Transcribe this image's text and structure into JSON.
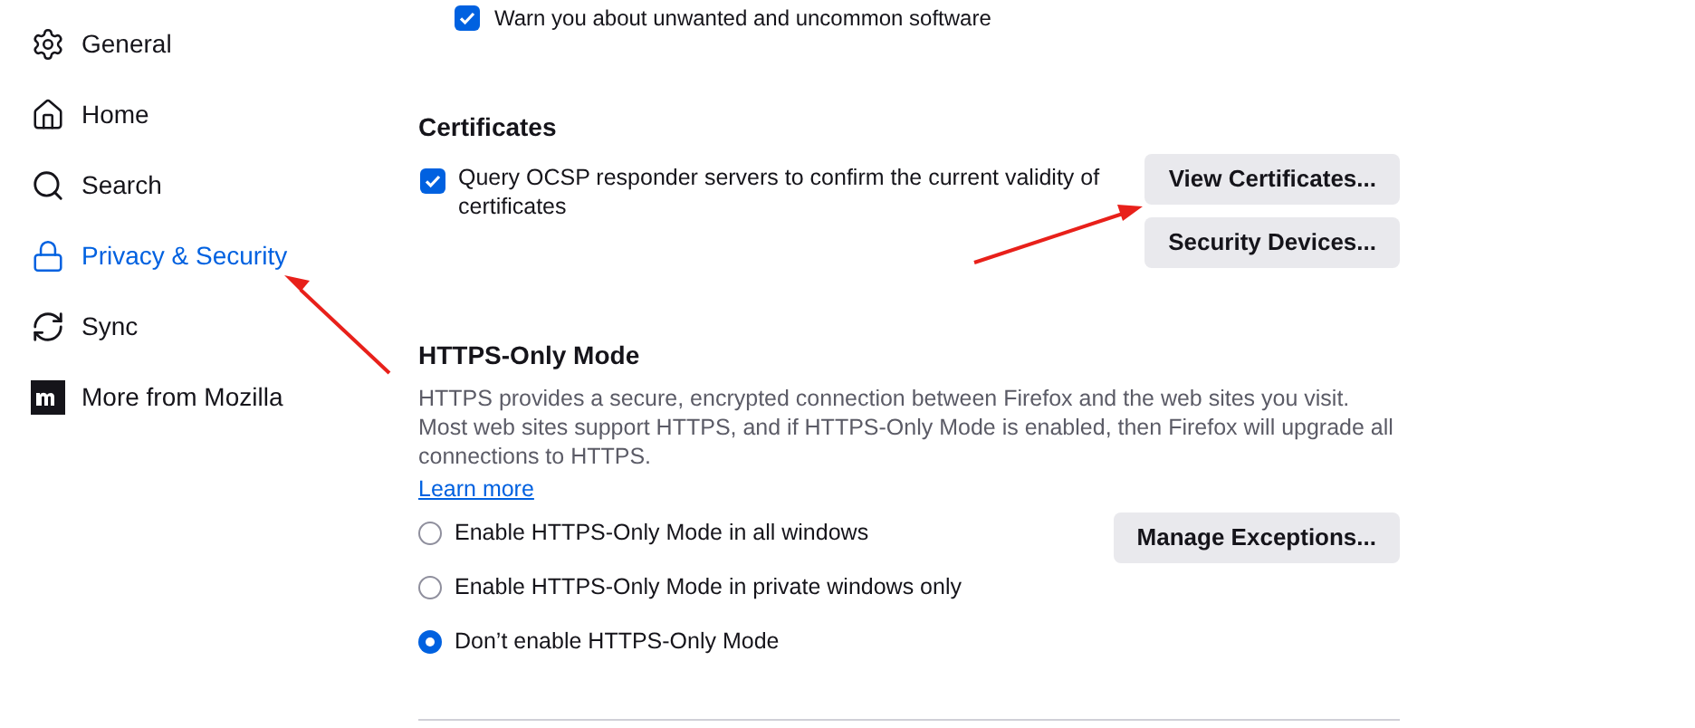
{
  "sidebar": {
    "items": [
      {
        "kind": "gear",
        "label": "General",
        "selected": false
      },
      {
        "kind": "home",
        "label": "Home",
        "selected": false
      },
      {
        "kind": "search",
        "label": "Search",
        "selected": false
      },
      {
        "kind": "lock",
        "label": "Privacy & Security",
        "selected": true
      },
      {
        "kind": "sync",
        "label": "Sync",
        "selected": false
      },
      {
        "kind": "mozilla",
        "label": "More from Mozilla",
        "selected": false
      }
    ]
  },
  "top_option": {
    "label": "Warn you about unwanted and uncommon software",
    "checked": true
  },
  "certificates": {
    "heading": "Certificates",
    "option": {
      "label": "Query OCSP responder servers to confirm the current validity of certificates",
      "checked": true
    },
    "buttons": [
      "View Certificates...",
      "Security Devices..."
    ]
  },
  "https_only": {
    "heading": "HTTPS-Only Mode",
    "description": "HTTPS provides a secure, encrypted connection between Firefox and the web sites you visit. Most web sites support HTTPS, and if HTTPS-Only Mode is enabled, then Firefox will upgrade all connections to HTTPS.",
    "link": "Learn more",
    "options": [
      {
        "label": "Enable HTTPS-Only Mode in all windows",
        "selected": false
      },
      {
        "label": "Enable HTTPS-Only Mode in private windows only",
        "selected": false
      },
      {
        "label": "Don’t enable HTTPS-Only Mode",
        "selected": true
      }
    ],
    "button": "Manage Exceptions..."
  }
}
